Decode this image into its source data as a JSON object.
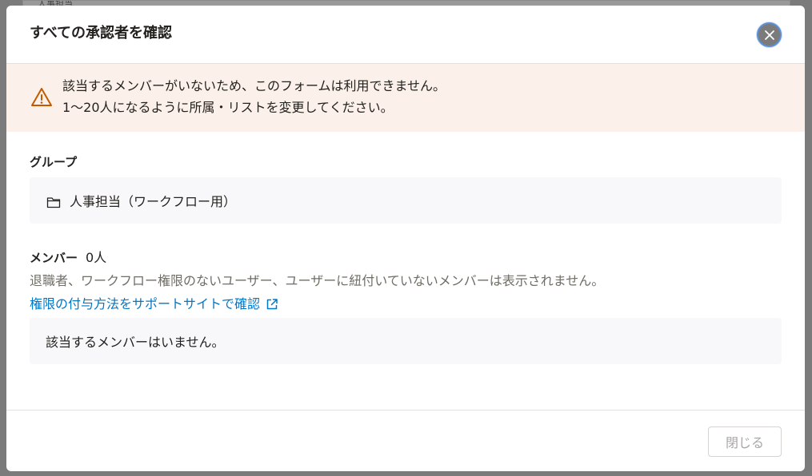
{
  "background": {
    "strip_text": "人事担当"
  },
  "dialog": {
    "title": "すべての承認者を確認",
    "close_icon": "close-icon",
    "warning": {
      "icon": "warning-triangle-icon",
      "line1": "該当するメンバーがいないため、このフォームは利用できません。",
      "line2": "1〜20人になるように所属・リストを変更してください。",
      "color": "#c35a00"
    },
    "group": {
      "label": "グループ",
      "icon": "folder-icon",
      "name": "人事担当（ワークフロー用）"
    },
    "members": {
      "label": "メンバー",
      "count": "0人",
      "note": "退職者、ワークフロー権限のないユーザー、ユーザーに紐付いていないメンバーは表示されません。",
      "link_text": "権限の付与方法をサポートサイトで確認",
      "link_icon": "external-link-icon",
      "empty_text": "該当するメンバーはいません。"
    },
    "footer": {
      "close_label": "閉じる"
    }
  },
  "colors": {
    "link": "#0077c7",
    "warning_bg": "#fbf0ea",
    "box_bg": "#f8f8fa"
  }
}
